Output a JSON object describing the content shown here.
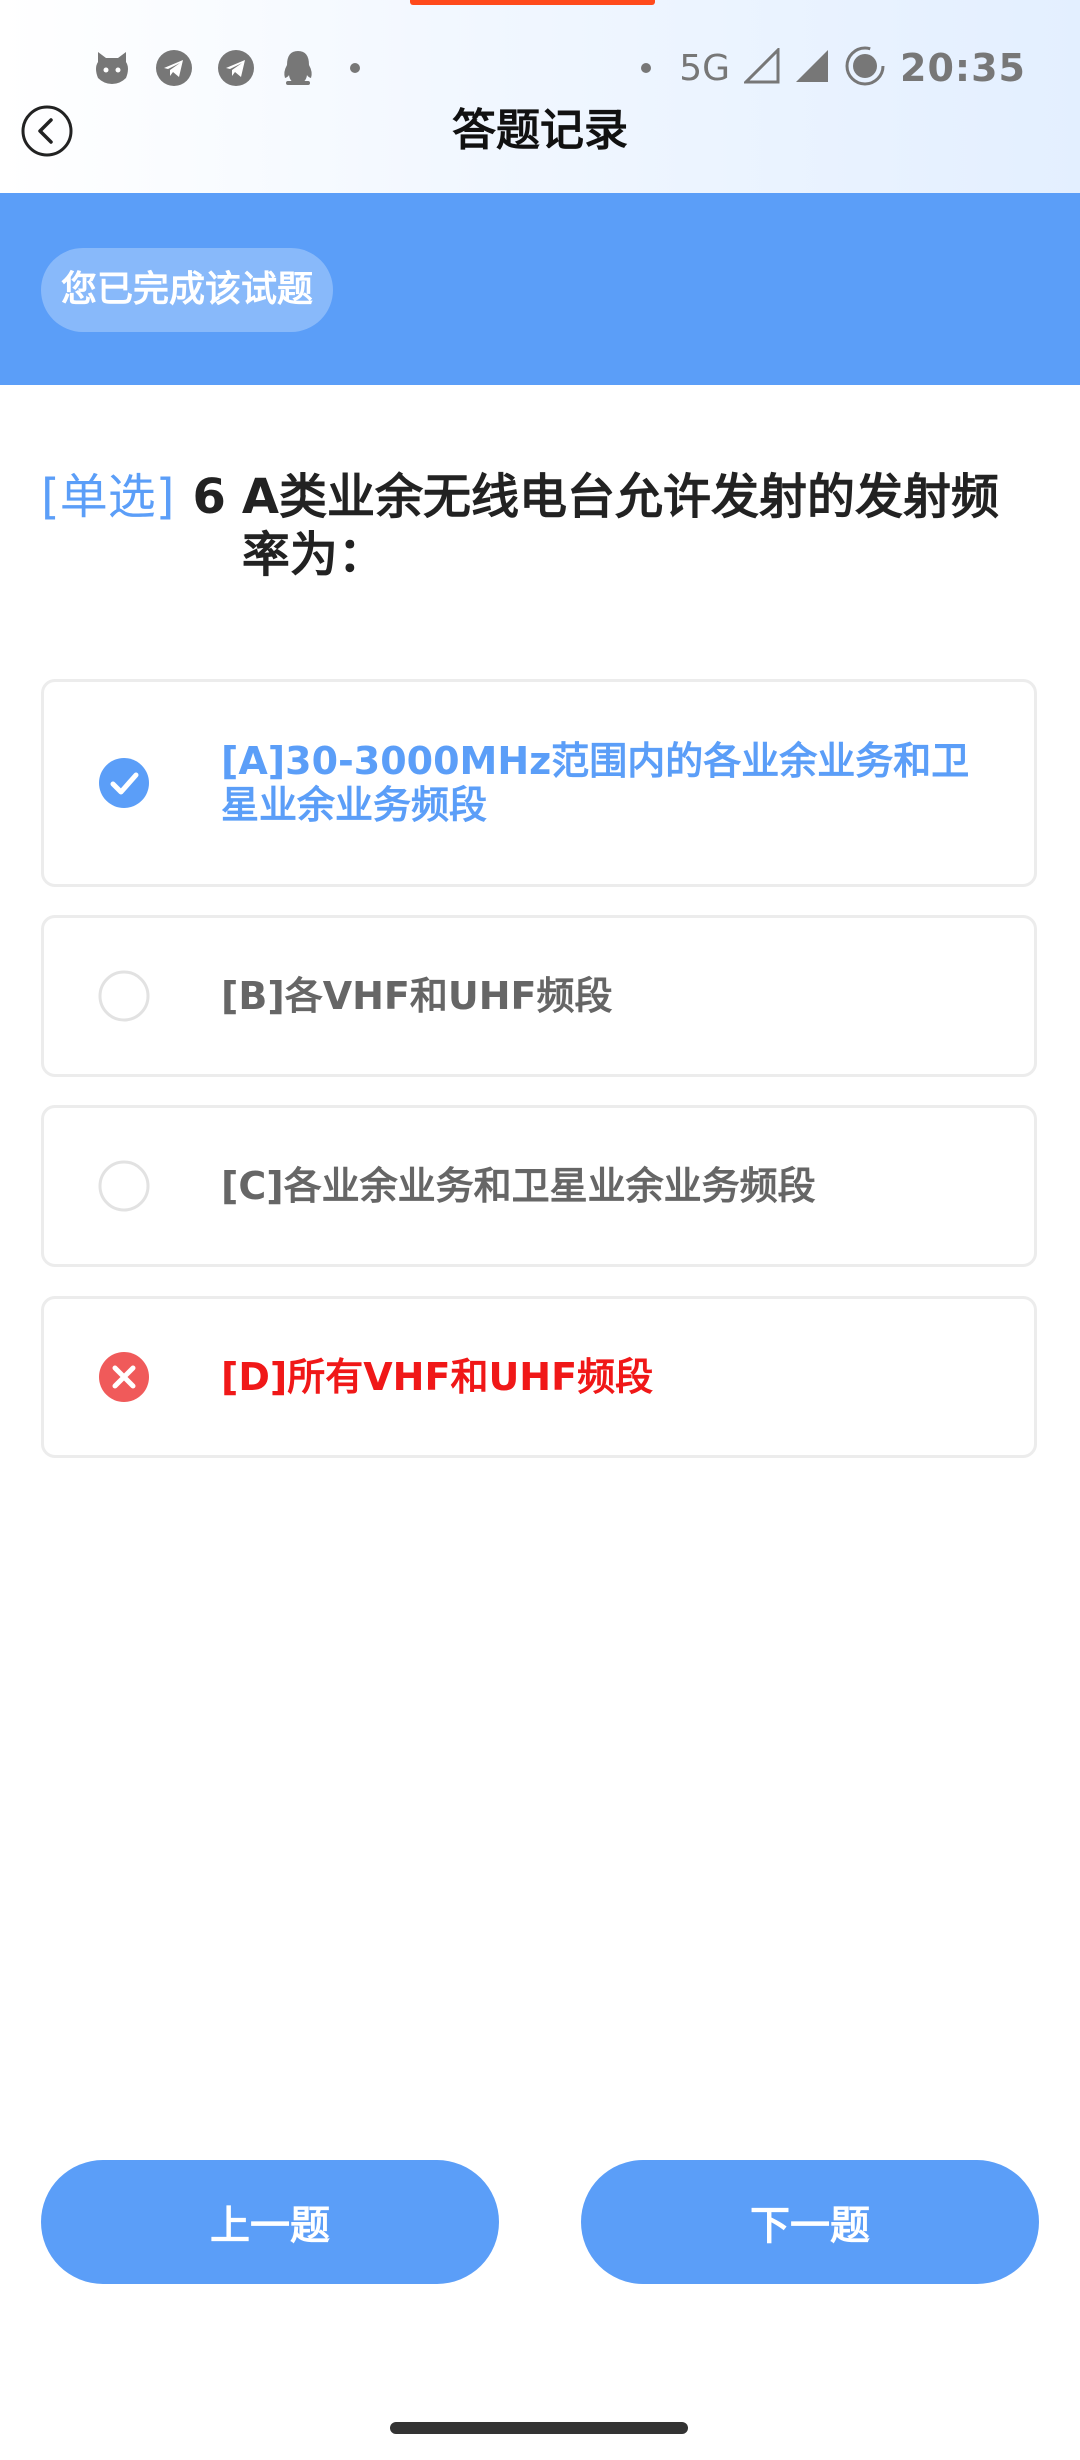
{
  "status_bar": {
    "network": "5G",
    "time": "20:35",
    "icons": [
      "cat-app-icon",
      "telegram-icon",
      "telegram-icon",
      "qq-penguin-icon"
    ]
  },
  "header": {
    "title": "答题记录",
    "back_icon": "back-arrow-icon"
  },
  "banner": {
    "status": "您已完成该试题"
  },
  "question": {
    "type": "[单选]",
    "number": "6",
    "text": "A类业余无线电台允许发射的发射频率为："
  },
  "options": [
    {
      "label": "[A]30-3000MHz范围内的各业余业务和卫星业余业务频段",
      "state": "correct"
    },
    {
      "label": "[B]各VHF和UHF频段",
      "state": "unselected"
    },
    {
      "label": "[C]各业余业务和卫星业余业务频段",
      "state": "unselected"
    },
    {
      "label": "[D]所有VHF和UHF频段",
      "state": "wrong"
    }
  ],
  "buttons": {
    "prev": "上一题",
    "next": "下一题"
  },
  "colors": {
    "primary": "#5b9ef8",
    "error": "#f05a5a",
    "accent": "#ff4a1c"
  }
}
